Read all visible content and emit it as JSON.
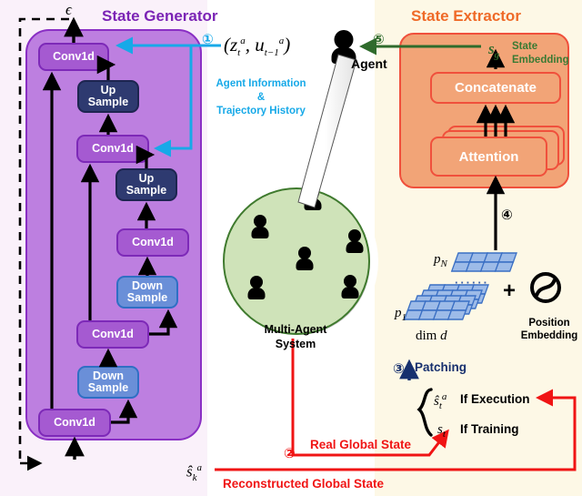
{
  "figure": {
    "title_generator": "State Generator",
    "title_extractor": "State Extractor"
  },
  "colors": {
    "generator_purple": "#bd7fe0",
    "generator_border": "#8a2fc4",
    "conv_fill": "#a55ad1",
    "upsample_fill": "#2e3a70",
    "downsample_fill": "#6a8fd8",
    "extractor_fill": "#f2a477",
    "extractor_border": "#f0503c",
    "circle_green": "#cfe3b9",
    "cyan_accent": "#17a9e8",
    "red_accent": "#f01414",
    "green_accent": "#2f6b2c",
    "navy_accent": "#17306e",
    "panel_left_bg": "#faf1fa",
    "panel_right_bg": "#fdf8e6"
  },
  "generator": {
    "blocks": [
      {
        "label": "Conv1d",
        "type": "conv"
      },
      {
        "label": "Up\nSample",
        "type": "upsample"
      },
      {
        "label": "Conv1d",
        "type": "conv"
      },
      {
        "label": "Up\nSample",
        "type": "upsample"
      },
      {
        "label": "Conv1d",
        "type": "conv"
      },
      {
        "label": "Down\nSample",
        "type": "downsample"
      },
      {
        "label": "Conv1d",
        "type": "conv"
      },
      {
        "label": "Down\nSample",
        "type": "downsample"
      },
      {
        "label": "Conv1d",
        "type": "conv"
      }
    ],
    "output_symbol": "ϵ",
    "input_symbol": "ŝᵏᵃ",
    "conv_label": "Conv1d",
    "up_label_line1": "Up",
    "up_label_line2": "Sample",
    "down_label_line1": "Down",
    "down_label_line2": "Sample"
  },
  "extractor": {
    "concatenate_label": "Concatenate",
    "attention_label": "Attention",
    "output_symbol": "s_g",
    "output_caption": "State Embedding"
  },
  "multi_agent": {
    "label_line1": "Multi-Agent",
    "label_line2": "System",
    "agent_label": "Agent",
    "agent_count": 6
  },
  "patches": {
    "pN_label": "p_N",
    "p1_label": "p_1",
    "ellipsis": "······",
    "dim_label": "dim d",
    "plus": "+",
    "position_embedding": "Position Embedding"
  },
  "annotations": {
    "step1": "①",
    "step2": "②",
    "step3": "③",
    "step4": "④",
    "step5": "⑤",
    "agent_input_math": "(z_t^a, u_{t-1}^a)",
    "agent_info_text": "Agent Information & Trajectory History",
    "patching_label": "Patching",
    "if_execution": "If Execution",
    "if_training": "If Training",
    "state_exec_symbol": "ŝ_t^a",
    "state_train_symbol": "s_t",
    "real_global_state": "Real Global State",
    "reconstructed_global_state": "Reconstructed Global State"
  }
}
